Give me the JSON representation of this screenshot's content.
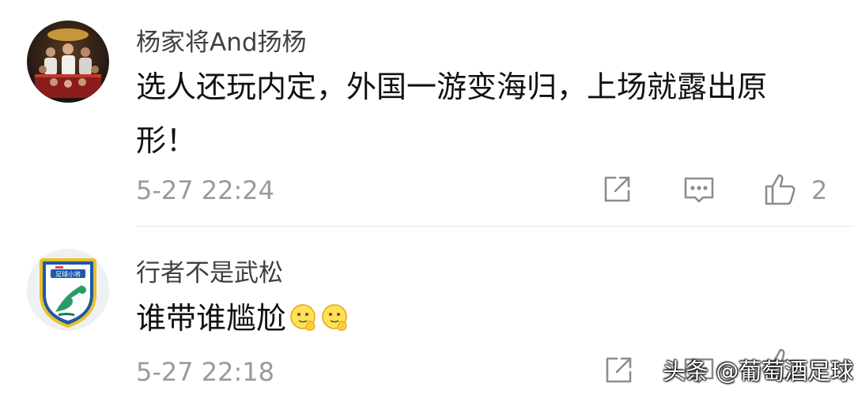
{
  "comments": [
    {
      "username": "杨家将And扬杨",
      "text": "选人还玩内定，外国一游变海归，上场就露出原形！",
      "time": "5-27 22:24",
      "likes": "2",
      "avatar_icon": "basketball-team-photo-avatar"
    },
    {
      "username": "行者不是武松",
      "text": "谁带谁尴尬",
      "emoji": [
        "salute-emoji",
        "salute-emoji"
      ],
      "time": "5-27 22:18",
      "likes": "",
      "avatar_icon": "football-club-badge-avatar",
      "avatar_badge_text": "足球小将"
    }
  ],
  "actions": {
    "share_icon": "share-icon",
    "reply_icon": "reply-icon",
    "like_icon": "thumbs-up-icon"
  },
  "watermark": "头条 @葡萄酒足球",
  "colors": {
    "username": "#404040",
    "text": "#111111",
    "meta": "#9a9a9a"
  }
}
